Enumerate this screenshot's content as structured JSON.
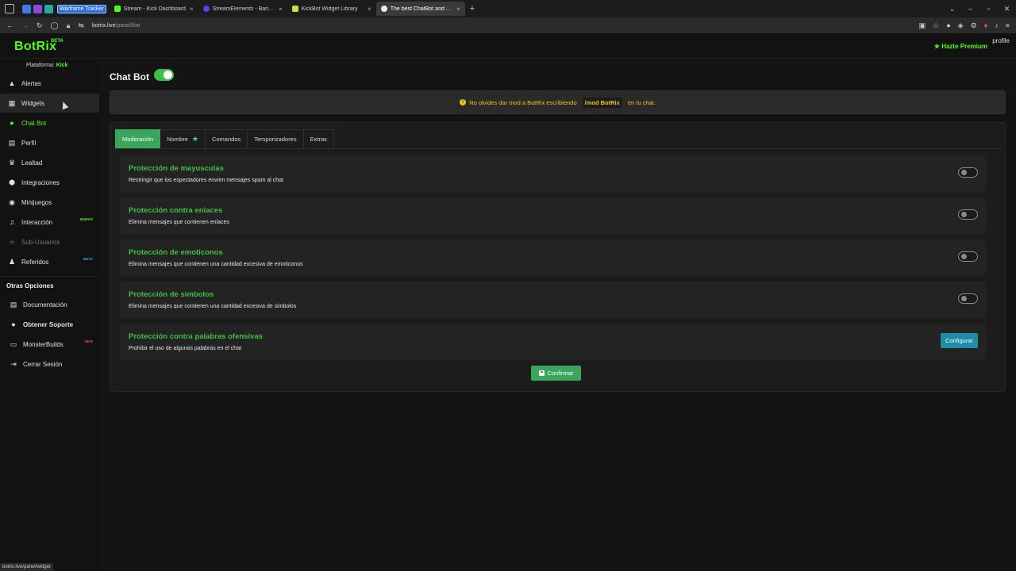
{
  "browser": {
    "pinned_tabs": [
      {
        "icon": "blue-square-icon",
        "color": "#3b7ddd"
      },
      {
        "icon": "purple-square-icon",
        "color": "#8a4bd8"
      },
      {
        "icon": "teal-square-icon",
        "color": "#2aa7a0"
      }
    ],
    "pinned_label": "Warframe Tracker",
    "tabs": [
      {
        "label": "Stream - Kick Dashboard",
        "fav_color": "#53fc18",
        "close": "×"
      },
      {
        "label": "StreamElements - Banned words",
        "fav_color": "#4f46e5",
        "close": "×"
      },
      {
        "label": "KickBot Widget Library",
        "fav_color": "#c6e33a",
        "close": "×"
      },
      {
        "label": "The best ChatBot and Widgets",
        "fav_color": "#eeeeee",
        "close": "×"
      }
    ],
    "new_tab": "+",
    "url_host": "botrix.live",
    "url_path": "/panel/bot",
    "status_url": "botrix.live/panel/widget"
  },
  "header": {
    "logo": "BotRix",
    "logo_badge": "BETA",
    "premium": "Hazte Premium",
    "profile": "profile"
  },
  "sidebar": {
    "platform_label": "Plataforma:",
    "platform_value": "Kick",
    "items": [
      {
        "label": "Alertas",
        "icon": "warning-icon",
        "glyph": "▲"
      },
      {
        "label": "Widgets",
        "icon": "grid-icon",
        "glyph": "▦"
      },
      {
        "label": "Chat Bot",
        "icon": "robot-icon",
        "glyph": "●"
      },
      {
        "label": "Perfil",
        "icon": "id-card-icon",
        "glyph": "▤"
      },
      {
        "label": "Lealtad",
        "icon": "trophy-icon",
        "glyph": "♛"
      },
      {
        "label": "Integraciones",
        "icon": "cubes-icon",
        "glyph": "⬢"
      },
      {
        "label": "Minijuegos",
        "icon": "gamepad-icon",
        "glyph": "◉"
      },
      {
        "label": "Interacción",
        "icon": "music-icon",
        "glyph": "♫",
        "badge": "NUEVO"
      },
      {
        "label": "Sub-Usuarios",
        "icon": "link-icon",
        "glyph": "∞"
      },
      {
        "label": "Referidos",
        "icon": "users-icon",
        "glyph": "♟",
        "badge": "BETA"
      }
    ],
    "other_heading": "Otras Opciones",
    "other_items": [
      {
        "label": "Documentación",
        "icon": "book-icon",
        "glyph": "▤"
      },
      {
        "label": "Obtener Soporte",
        "icon": "discord-icon",
        "glyph": "●"
      },
      {
        "label": "MonsterBuilds",
        "icon": "monitor-icon",
        "glyph": "▭",
        "badge": "NEW"
      },
      {
        "label": "Cerrar Sesión",
        "icon": "logout-icon",
        "glyph": "⇥"
      }
    ]
  },
  "main": {
    "title": "Chat Bot",
    "notice_before": "No olvides dar mod a BotRix escribiendo",
    "notice_cmd": "/mod BotRix",
    "notice_after": "en tu chat.",
    "tabs": [
      "Moderación",
      "Nombre",
      "Comandos",
      "Temporizadores",
      "Extras"
    ],
    "rows": [
      {
        "title": "Protección de mayusculas",
        "desc": "Restringir que los espectadores envíen mensajes spam al chat"
      },
      {
        "title": "Protección contra enlaces",
        "desc": "Elimina mensajes que contienen enlaces"
      },
      {
        "title": "Protección de emoticonos",
        "desc": "Elimina mensajes que contienen una cantidad excesiva de emoticonos"
      },
      {
        "title": "Protección de simbolos",
        "desc": "Elimina mensajes que contienen una cantidad excesiva de simbolos"
      },
      {
        "title": "Protección contra palabras ofensivas",
        "desc": "Prohibir el uso de algunas palabras en el chat",
        "button": "Configurar"
      }
    ],
    "confirm": "Confirmar"
  },
  "colors": {
    "accent": "#53fc18",
    "green_button": "#3ba55c",
    "config_button": "#1d8ea8",
    "warning": "#f0c419"
  }
}
